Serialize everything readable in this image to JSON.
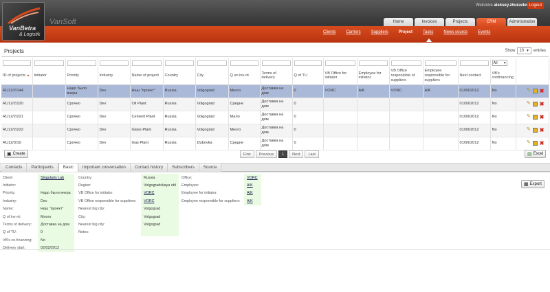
{
  "brand": {
    "logo_text": "VanBetra",
    "logo_sub": "& Logistik",
    "app_name": "VanSoft"
  },
  "user": {
    "welcome_prefix": "Welcome",
    "name": "aleksey.zhuravlev",
    "logout": "Logout"
  },
  "main_tabs": [
    "Home",
    "Invoices",
    "Projects",
    "CRM",
    "Administration"
  ],
  "sub_nav": [
    "Clients",
    "Carriers",
    "Suppliers",
    "Project",
    "Tasks",
    "News source",
    "Events"
  ],
  "page": {
    "title": "Projects",
    "show_label": "Show",
    "show_value": "10",
    "show_suffix": "entries",
    "filter_all": "All"
  },
  "table": {
    "headers": [
      "ID of projects",
      "Initiator",
      "Priority",
      "Industry",
      "Name of project",
      "Country",
      "City",
      "Q un inv-nt",
      "Terms of delivery",
      "Q of TU",
      "VB Office for initiator",
      "Employee for initiator",
      "VB Office responsible of suppliers",
      "Employee responsible for suppliers",
      "Next contact",
      "VB's confinancing"
    ],
    "rows": [
      [
        "RU12/2/144",
        "",
        "Надо было вчера",
        "Dev",
        "Наш \"проект\"",
        "Russia",
        "Volgograd",
        "Много",
        "Доставка на дом",
        "0",
        "VORC",
        "AIK",
        "VORC",
        "AIK",
        "01/09/2012",
        "No"
      ],
      [
        "RU12/2/220",
        "",
        "Срочно",
        "Dev",
        "Oil Plant",
        "Russia",
        "Volgograd",
        "Средне",
        "Доставка на дом",
        "0",
        "",
        "",
        "",
        "",
        "01/09/2012",
        "No"
      ],
      [
        "RU12/2/221",
        "",
        "Срочно",
        "Dev",
        "Cement Plant",
        "Russia",
        "Volgograd",
        "Мало",
        "Доставка на дом",
        "0",
        "",
        "",
        "",
        "",
        "01/09/2012",
        "No"
      ],
      [
        "RU12/2/222",
        "",
        "Срочно",
        "Dev",
        "Glass Plant",
        "Russia",
        "Volgograd",
        "Много",
        "Доставка на дом",
        "0",
        "",
        "",
        "",
        "",
        "01/09/2012",
        "No"
      ],
      [
        "RU12/3/10",
        "",
        "Срочно",
        "Dev",
        "Gas Plant",
        "Russia",
        "Dubovka",
        "Средне",
        "Доставка на дом",
        "0",
        "",
        "",
        "",
        "",
        "01/09/2012",
        "No"
      ]
    ]
  },
  "buttons": {
    "create": "Create",
    "excel": "Excel",
    "export": "Export"
  },
  "pager": {
    "first": "First",
    "previous": "Previous",
    "current": "1",
    "next": "Next",
    "last": "Last"
  },
  "detail_tabs": [
    "Contacts",
    "Participants",
    "Basic",
    "Important conversation",
    "Contact history",
    "Subscribers",
    "Source"
  ],
  "detail": {
    "col1": [
      [
        "Client:",
        "Singularis Lab"
      ],
      [
        "Initiator:",
        ""
      ],
      [
        "Priority:",
        "Надо было вчера"
      ],
      [
        "Industry:",
        "Dev"
      ],
      [
        "Name:",
        "Наш \"проект\""
      ],
      [
        "Q of inv-nt:",
        "Много"
      ],
      [
        "Terms of delivery:",
        "Доставка на дом"
      ],
      [
        "Q of TU:",
        "0"
      ],
      [
        "VB's co-financing:",
        "No"
      ],
      [
        "Delivery start:",
        "02/02/2012"
      ]
    ],
    "col2": [
      [
        "Country:",
        "Russia"
      ],
      [
        "Region:",
        "Volgogradskaya obl"
      ],
      [
        "VB Office for initiator:",
        "VORC"
      ],
      [
        "VB Office responsible for suppliers:",
        "VORC"
      ],
      [
        "Nearest big city:",
        "Volgograd"
      ],
      [
        "City:",
        "Volgograd"
      ],
      [
        "Nearest big city:",
        "Volgograd"
      ],
      [
        "Notes:",
        ""
      ]
    ],
    "col3": [
      [
        "Office:",
        "VORC"
      ],
      [
        "Employee:",
        "AIK"
      ],
      [
        "Employee for initiator:",
        "AIK"
      ],
      [
        "Employee responsible for suppliers:",
        "AIK"
      ]
    ]
  }
}
